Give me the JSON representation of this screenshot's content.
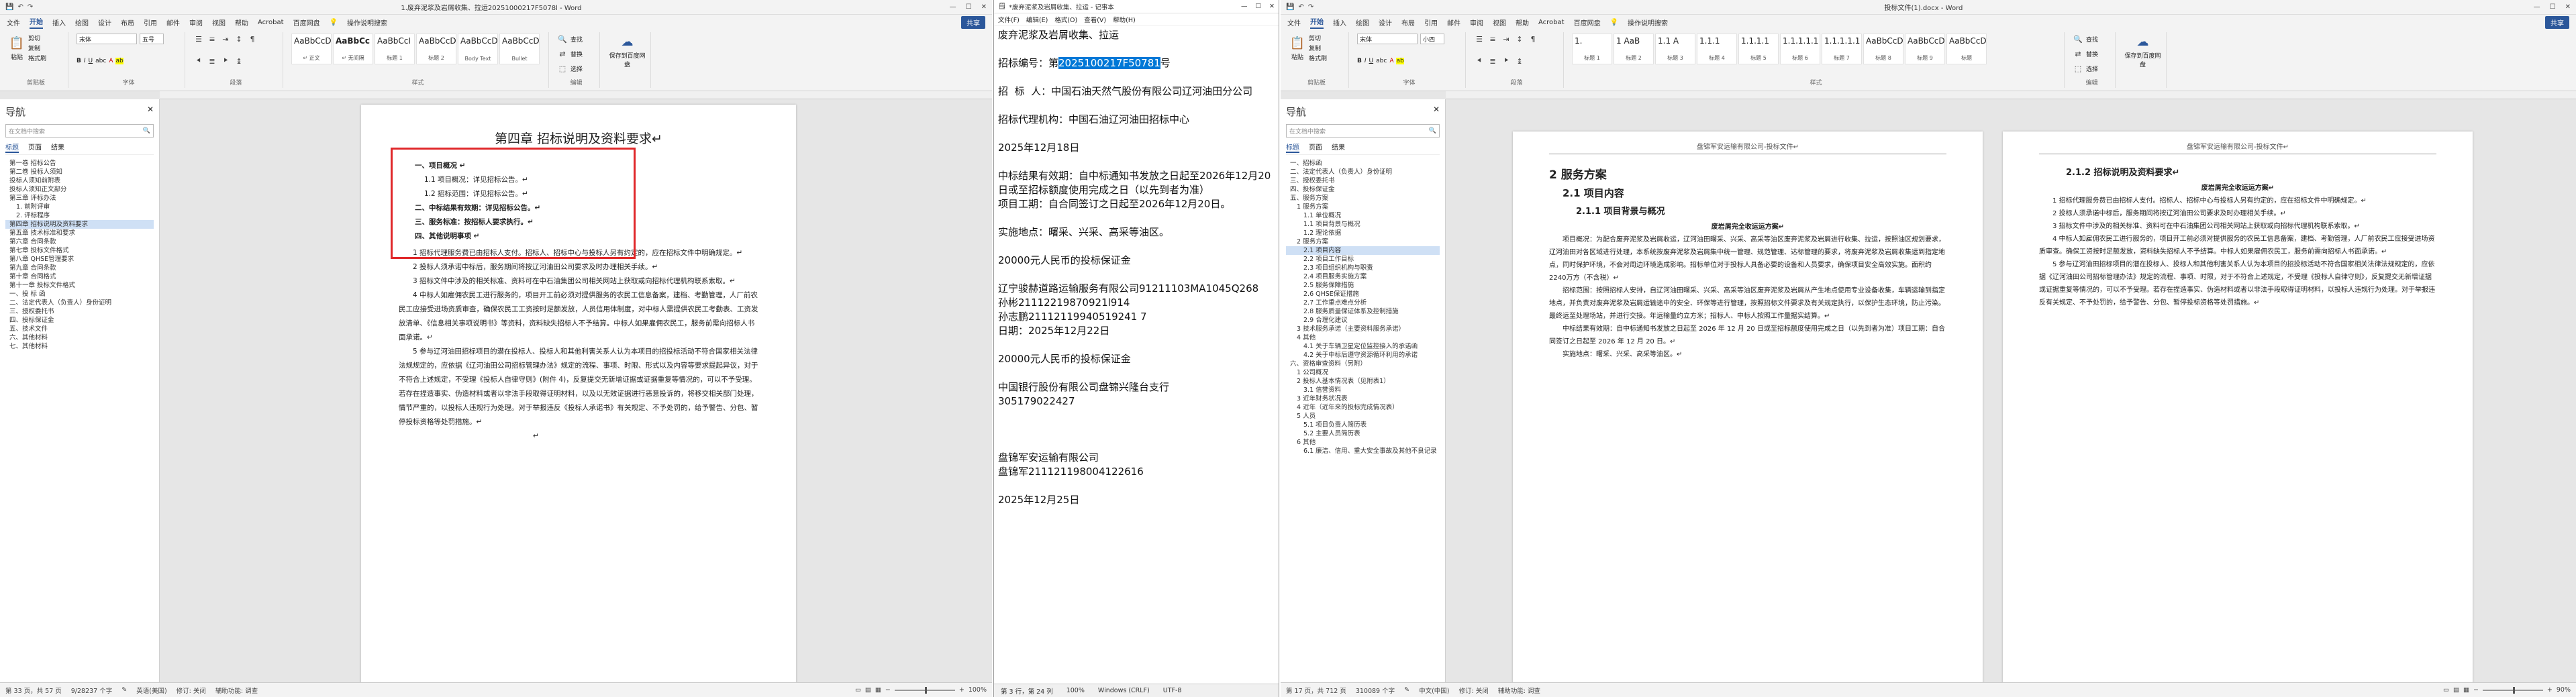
{
  "left": {
    "title": "1.废弃泥浆及岩屑收集、拉运20251000217F5078l - Word",
    "tabs": [
      "文件",
      "开始",
      "插入",
      "绘图",
      "设计",
      "布局",
      "引用",
      "邮件",
      "审阅",
      "视图",
      "帮助",
      "Acrobat",
      "百度网盘"
    ],
    "active_tab": "开始",
    "tell_me": "操作说明搜索",
    "share": "共享",
    "clipboard": {
      "paste": "粘贴",
      "cut": "剪切",
      "copy": "复制",
      "format_painter": "格式刷",
      "label": "剪贴板"
    },
    "font": {
      "name": "宋体",
      "size": "五号",
      "label": "字体"
    },
    "paragraph_label": "段落",
    "styles": [
      {
        "sample": "AaBbCcDc",
        "name": "↵ 正文"
      },
      {
        "sample": "AaBbCc",
        "name": "↵ 无间隔"
      },
      {
        "sample": "AaBbCcI",
        "name": "标题 1"
      },
      {
        "sample": "AaBbCcD",
        "name": "标题 2"
      },
      {
        "sample": "AaBbCcD",
        "name": "Body Text"
      },
      {
        "sample": "AaBbCcD",
        "name": "Bullet"
      }
    ],
    "styles_label": "样式",
    "editing": {
      "find": "查找",
      "replace": "替换",
      "select": "选择",
      "label": "编辑"
    },
    "save_baidu": "保存到百度网盘",
    "nav": {
      "title": "导航",
      "search_placeholder": "在文档中搜索",
      "tabs": [
        "标题",
        "页面",
        "结果"
      ],
      "items": [
        "第一卷 招标公告",
        "第二卷 投标人须知",
        "投标人须知前附表",
        "投标人须知正文部分",
        "第三章 评标办法",
        "1. 前附评审",
        "2. 评标程序",
        "第四章 招标说明及资料要求",
        "第五章 技术标准和要求",
        "第六章 合同条款",
        "第七章 投标文件格式",
        "第八章 QHSE管理要求",
        "第九章 合同条款",
        "第十章 合同格式",
        "第十一章 投标文件格式",
        "一、投 标 函",
        "二、法定代表人（负责人）身份证明",
        "三、授权委托书",
        "四、投标保证金",
        "五、技术文件",
        "六、其他材料",
        "七、其他材料"
      ],
      "selected": 7
    },
    "doc": {
      "chapter": "第四章  招标说明及资料要求↵",
      "box_lines": [
        "一、项目概况 ↵",
        "1.1 项目概况：详见招标公告。↵",
        "1.2 招标范围：详见招标公告。↵",
        "二、中标结果有效期：详见招标公告。↵",
        "三、服务标准：按招标人要求执行。↵",
        "四、其他说明事项 ↵"
      ],
      "paras": [
        "1 招标代理服务费已由招标人支付。招标人、招标中心与投标人另有约定的，应在招标文件中明确规定。↵",
        "2 投标人须承诺中标后，服务期间将按辽河油田公司要求及时办理相关手续。↵",
        "3 招标文件中涉及的相关标准、资料可在中石油集团公司相关网站上获取或向招标代理机构联系索取。↵",
        "4 中标人如雇佣农民工进行服务的，项目开工前必须对提供服务的农民工信息备案，建档、考勤管理，人厂前农民工应接受进场资质审查，确保农民工工资按时足额发放，人员信用体制度，对中标人需提供农民工考勤表、工资发放清单、《信息相关事项说明书》等资料，资料缺失招标人不予结算。中标人如果雇佣农民工，服务前需向招标人书面承诺。↵",
        "5 参与辽河油田招标项目的潜在投标人、投标人和其他利害关系人认为本项目的招投标活动不符合国家相关法律法规规定的，应依据《辽河油田公司招标管理办法》规定的流程、事项、时限、形式以及内容等要求提起异议，对于不符合上述规定，不受理《投标人自律守则》(附件 4)，反复提交无新增证据或证据重复等情况的，可以不予受理。若存在捏造事实、伪造材料或者以非法手段取得证明材料，以及以无效证据进行恶意投诉的，将移交相关部门处理，情节严重的，以投标人违规行为处理。对于举报违反《投标人承诺书》有关规定、不予处罚的，给予警告、分包、暂停投标资格等处罚措施。↵"
      ],
      "end_mark": "↵"
    },
    "status": {
      "page": "第 33 页，共 57 页",
      "words": "9/28237 个字",
      "lang": "英语(美国)",
      "track": "修订: 关闭",
      "access": "辅助功能: 调查",
      "zoom": "100%"
    }
  },
  "notepad": {
    "title": "*废弃泥浆及岩屑收集、拉运 - 记事本",
    "menu": [
      "文件(F)",
      "编辑(E)",
      "格式(O)",
      "查看(V)",
      "帮助(H)"
    ],
    "lines": [
      {
        "t": "废弃泥浆及岩屑收集、拉运"
      },
      {
        "t": ""
      },
      {
        "t": "招标编号：第",
        "sel": "2025100217F50781",
        "rest": "号"
      },
      {
        "t": ""
      },
      {
        "t": "招  标  人：中国石油天然气股份有限公司辽河油田分公司"
      },
      {
        "t": ""
      },
      {
        "t": "招标代理机构：中国石油辽河油田招标中心"
      },
      {
        "t": ""
      },
      {
        "t": "2025年12月18日"
      },
      {
        "t": ""
      },
      {
        "t": "中标结果有效期：自中标通知书发放之日起至2026年12月20日或至招标额度使用完成之日（以先到者为准）"
      },
      {
        "t": "项目工期：自合同签订之日起至2026年12月20日。"
      },
      {
        "t": ""
      },
      {
        "t": "实施地点：曙采、兴采、高采等油区。"
      },
      {
        "t": ""
      },
      {
        "t": "20000元人民币的投标保证金"
      },
      {
        "t": ""
      },
      {
        "t": "辽宁骏赫道路运输服务有限公司91211103MA1045Q268"
      },
      {
        "t": "孙彬21112219870921l914"
      },
      {
        "t": "孙志鹏21112119940519241 7"
      },
      {
        "t": "日期：2025年12月22日"
      },
      {
        "t": ""
      },
      {
        "t": "20000元人民币的投标保证金"
      },
      {
        "t": ""
      },
      {
        "t": "中国银行股份有限公司盘锦兴隆台支行"
      },
      {
        "t": "305179022427"
      },
      {
        "t": ""
      },
      {
        "t": ""
      },
      {
        "t": ""
      },
      {
        "t": "盘锦军安运输有限公司"
      },
      {
        "t": "盘锦军211121198004122616"
      },
      {
        "t": ""
      },
      {
        "t": "2025年12月25日"
      }
    ],
    "status": {
      "pos": "第 3 行，第 24 列",
      "zoom": "100%",
      "eol": "Windows (CRLF)",
      "enc": "UTF-8"
    }
  },
  "right": {
    "title": "投标文件(1).docx - Word",
    "tabs": [
      "文件",
      "开始",
      "插入",
      "绘图",
      "设计",
      "布局",
      "引用",
      "邮件",
      "审阅",
      "视图",
      "帮助",
      "Acrobat",
      "百度网盘"
    ],
    "active_tab": "开始",
    "tell_me": "操作说明搜索",
    "share": "共享",
    "font": {
      "name": "宋体",
      "size": "小四",
      "label": "字体"
    },
    "styles": [
      {
        "sample": "1.",
        "name": "标题 1"
      },
      {
        "sample": "1 AaB",
        "name": "标题 2"
      },
      {
        "sample": "1.1 A",
        "name": "标题 3"
      },
      {
        "sample": "1.1.1",
        "name": "标题 4"
      },
      {
        "sample": "1.1.1.1",
        "name": "标题 5"
      },
      {
        "sample": "1.1.1.1.1",
        "name": "标题 6"
      },
      {
        "sample": "1.1.1.1.1",
        "name": "标题 7"
      },
      {
        "sample": "AaBbCcD",
        "name": "标题 8"
      },
      {
        "sample": "AaBbCcD",
        "name": "标题 9"
      },
      {
        "sample": "AaBbCcD",
        "name": "标题"
      }
    ],
    "nav": {
      "title": "导航",
      "search_placeholder": "在文档中搜索",
      "tabs": [
        "标题",
        "页面",
        "结果"
      ],
      "items": [
        "一、招标函",
        "二、法定代表人（负责人）身份证明",
        "三、授权委托书",
        "四、投标保证金",
        "五、服务方案",
        "1 服务方案",
        "1.1 单位概况",
        "1.1 项目背景与概况",
        "1.2 理论依据",
        "2 服务方案",
        "2.1 项目内容",
        "2.2 项目工作目标",
        "2.3 项目组织机构与职责",
        "2.4 项目服务实施方案",
        "2.5 服务保障措施",
        "2.6 QHSE保证措施",
        "2.7 工作重点难点分析",
        "2.8 服务质量保证体系及控制措施",
        "2.9 合理化建议",
        "3 技术服务承诺（主要资料服务承诺）",
        "4 其他",
        "4.1 关于车辆卫星定位监控接入的承诺函",
        "4.2 关于中标后遵守资源循环利用的承诺",
        "六、资格审查资料（另附）",
        "1 公司概况",
        "2 投标人基本情况表（见附表1）",
        "3.1 信誉资料",
        "3 近年财务状况表",
        "4 近年（近年来的投标完成情况表）",
        "5 人员",
        "5.1 项目负责人简历表",
        "5.2 主要人员简历表",
        "6 其他",
        "6.1 廉洁、信用、重大安全事故及其他不良记录"
      ],
      "selected": 10
    },
    "page1": {
      "header": "盘锦军安运输有限公司-投标文件↵",
      "h1": "2 服务方案",
      "h2": "2.1 项目内容",
      "h3": "2.1.1  项目背景与概况",
      "caption": "废岩屑完全收运运方案↵",
      "paras": [
        "项目概况：为配合废弃泥浆及岩屑收运，辽河油田曙采、兴采、高采等油区废弃泥浆及岩屑进行收集、拉运，按照油区规划要求，辽河油田对各区域进行处理，本系统按废弃泥浆及岩屑集中统一管理、规范管理、达标管理的要求，将废弃泥浆及岩屑收集运到指定地点，同时保护环境，不会对周边环境造成影响。招标单位对于投标人具备必要的设备和人员要求，确保项目安全高效实施。面积约2240万方（不含税）↵",
        "招标范围：按照招标人安排，自辽河油田曙采、兴采、高采等油区废弃泥浆及岩屑从产生地点使用专业设备收集，车辆运输到指定地点，并负责对废弃泥浆及岩屑运输途中的安全、环保等进行管理，按照招标文件要求及有关规定执行，以保护生态环境，防止污染。最终运至处理场站，并进行交接。年运输量约立方米；招标人、中标人按照工作量据实结算。↵",
        "中标结果有效期：自中标通知书发放之日起至 2026 年 12 月 20 日或至招标额度使用完成之日（以先到者为准）项目工期：自合同签订之日起至 2026 年 12 月 20 日。↵",
        "实施地点：曙采、兴采、高采等油区。↵"
      ]
    },
    "page2": {
      "header": "盘锦军安运输有限公司-投标文件↵",
      "h3": "2.1.2  招标说明及资料要求↵",
      "caption": "废岩屑完全收运运方案↵",
      "paras": [
        "1 招标代理服务费已由招标人支付。招标人、招标中心与投标人另有约定的，应在招标文件中明确规定。↵",
        "2 投标人须承诺中标后，服务期间将按辽河油田公司要求及时办理相关手续。↵",
        "3 招标文件中涉及的相关标准、资料可在中石油集团公司相关网站上获取或向招标代理机构联系索取。↵",
        "4 中标人如雇佣农民工进行服务的，项目开工前必须对提供服务的农民工信息备案，建档、考勤管理，人厂前农民工应接受进场资质审查。确保工资按时足额发放，资料缺失招标人不予结算。中标人如果雇佣农民工，服务前需向招标人书面承诺。↵",
        "5 参与辽河油田招标项目的潜在投标人、投标人和其他利害关系人认为本项目的招投标活动不符合国家相关法律法规规定的，应依据《辽河油田公司招标管理办法》规定的流程、事项、时限，对于不符合上述规定，不受理《投标人自律守则》，反复提交无新增证据或证据重复等情况的，可以不予受理。若存在捏造事实、伪造材料或者以非法手段取得证明材料，以投标人违规行为处理。对于举报违反有关规定、不予处罚的，给予警告、分包、暂停投标资格等处罚措施。↵"
      ]
    },
    "status": {
      "page": "第 17 页，共 712 页",
      "words": "310089 个字",
      "lang": "中文(中国)",
      "track": "修订: 关闭",
      "access": "辅助功能: 调查",
      "zoom": "90%"
    }
  },
  "colors": {
    "accent": "#2b579a",
    "red_box": "#e0282a",
    "selection": "#0078d7"
  }
}
